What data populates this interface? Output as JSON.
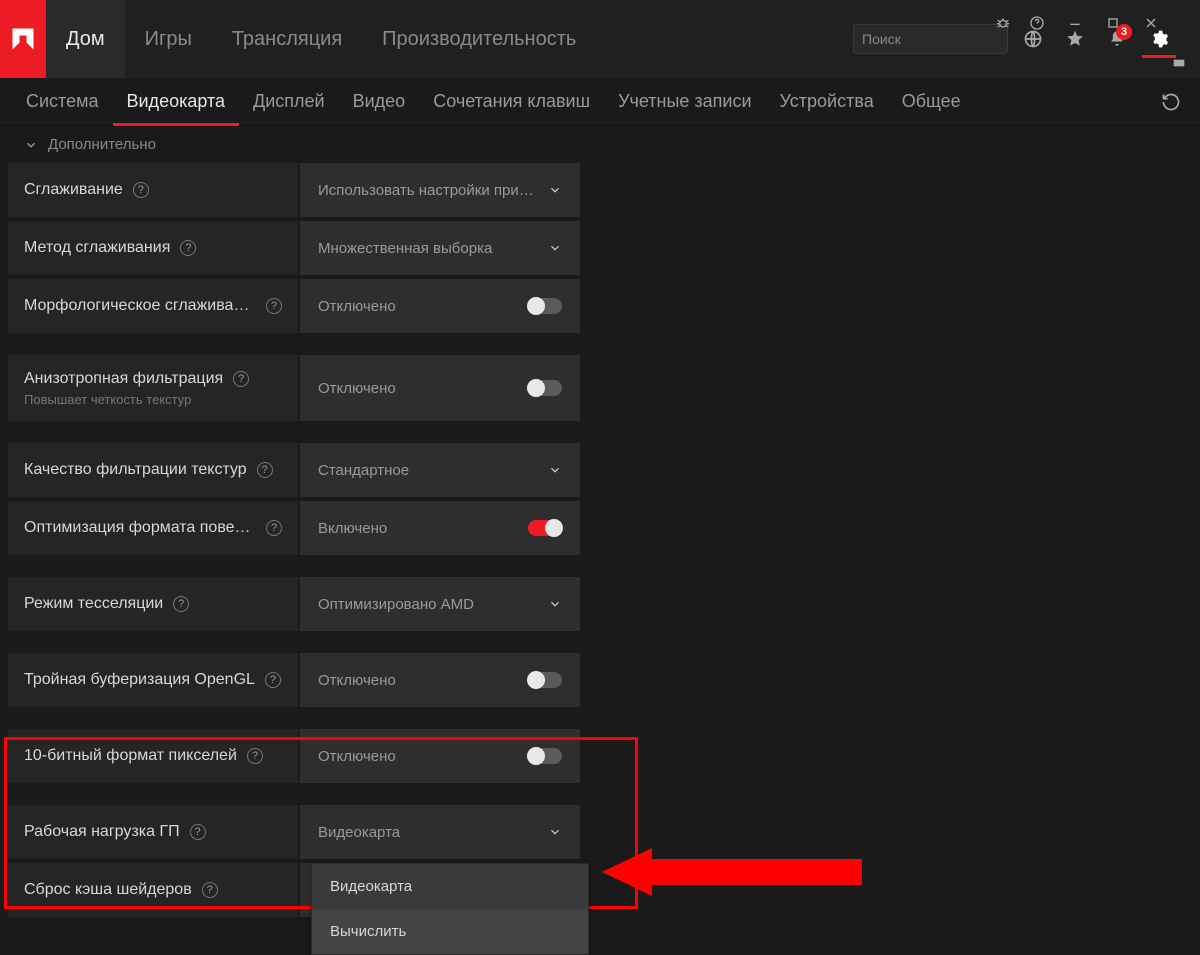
{
  "titlebar": {
    "tabs": [
      "Дом",
      "Игры",
      "Трансляция",
      "Производительность"
    ],
    "active_tab": 0,
    "search_placeholder": "Поиск",
    "notification_count": "3"
  },
  "subtabs": {
    "items": [
      "Система",
      "Видеокарта",
      "Дисплей",
      "Видео",
      "Сочетания клавиш",
      "Учетные записи",
      "Устройства",
      "Общее"
    ],
    "active": 1
  },
  "section": {
    "title": "Дополнительно"
  },
  "settings": {
    "antialiasing": {
      "label": "Сглаживание",
      "value": "Использовать настройки при…"
    },
    "aa_method": {
      "label": "Метод сглаживания",
      "value": "Множественная выборка"
    },
    "morph_aa": {
      "label": "Морфологическое сглаживание",
      "value": "Отключено",
      "on": false
    },
    "aniso": {
      "label": "Анизотропная фильтрация",
      "sub": "Повышает четкость текстур",
      "value": "Отключено",
      "on": false
    },
    "tex_quality": {
      "label": "Качество фильтрации текстур",
      "value": "Стандартное"
    },
    "surface_opt": {
      "label": "Оптимизация формата поверхн…",
      "value": "Включено",
      "on": true
    },
    "tess": {
      "label": "Режим тесселяции",
      "value": "Оптимизировано AMD"
    },
    "triple_buf": {
      "label": "Тройная буферизация OpenGL",
      "value": "Отключено",
      "on": false
    },
    "ten_bit": {
      "label": "10-битный формат пикселей",
      "value": "Отключено",
      "on": false
    },
    "gpu_workload": {
      "label": "Рабочая нагрузка ГП",
      "value": "Видеокарта",
      "options": [
        "Видеокарта",
        "Вычислить"
      ]
    },
    "shader_cache": {
      "label": "Сброс кэша шейдеров"
    }
  }
}
